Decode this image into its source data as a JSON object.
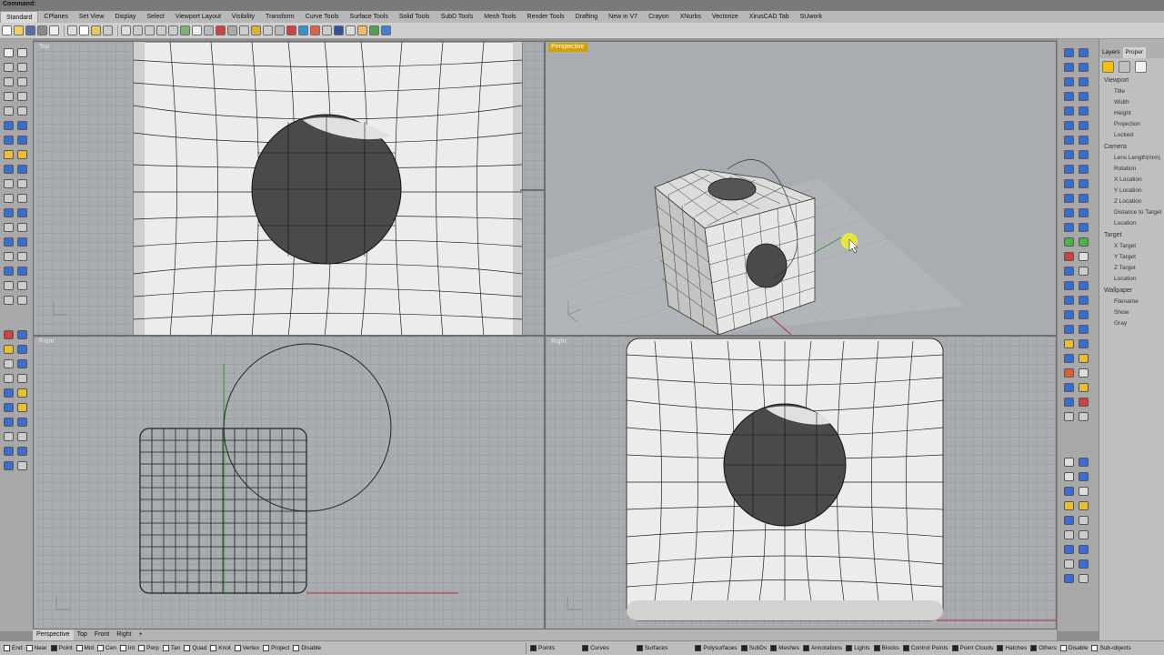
{
  "command": {
    "label": "Command:"
  },
  "tabs": [
    {
      "label": "Standard",
      "active": true
    },
    {
      "label": "CPlanes"
    },
    {
      "label": "Set View"
    },
    {
      "label": "Display"
    },
    {
      "label": "Select"
    },
    {
      "label": "Viewport Layout"
    },
    {
      "label": "Visibility"
    },
    {
      "label": "Transform"
    },
    {
      "label": "Curve Tools"
    },
    {
      "label": "Surface Tools"
    },
    {
      "label": "Solid Tools"
    },
    {
      "label": "SubD Tools"
    },
    {
      "label": "Mesh Tools"
    },
    {
      "label": "Render Tools"
    },
    {
      "label": "Drafting"
    },
    {
      "label": "New in V7"
    },
    {
      "label": "Crayon"
    },
    {
      "label": "XNurbs"
    },
    {
      "label": "Vectorize"
    },
    {
      "label": "XirusCAD Tab"
    },
    {
      "label": "SUwork"
    }
  ],
  "viewports": {
    "top": {
      "title": "Top"
    },
    "perspective": {
      "title": "Perspective"
    },
    "front": {
      "title": "Front"
    },
    "right": {
      "title": "Right"
    }
  },
  "viewport_tabs": [
    {
      "label": "Perspective",
      "active": true
    },
    {
      "label": "Top"
    },
    {
      "label": "Front"
    },
    {
      "label": "Right"
    },
    {
      "label": "+"
    }
  ],
  "osnaps": [
    {
      "label": "End",
      "checked": false
    },
    {
      "label": "Near",
      "checked": false
    },
    {
      "label": "Point",
      "checked": true
    },
    {
      "label": "Mid",
      "checked": false
    },
    {
      "label": "Cen",
      "checked": false
    },
    {
      "label": "Int",
      "checked": false
    },
    {
      "label": "Perp",
      "checked": false
    },
    {
      "label": "Tan",
      "checked": false
    },
    {
      "label": "Quad",
      "checked": false
    },
    {
      "label": "Knot",
      "checked": false
    },
    {
      "label": "Vertex",
      "checked": false
    },
    {
      "label": "Project",
      "checked": false
    },
    {
      "label": "Disable",
      "checked": false
    }
  ],
  "filters": [
    {
      "label": "Points"
    },
    {
      "label": "Curves"
    },
    {
      "label": "Surfaces"
    },
    {
      "label": "Polysurfaces"
    },
    {
      "label": "SubDs"
    },
    {
      "label": "Meshes"
    },
    {
      "label": "Annotations"
    },
    {
      "label": "Lights"
    },
    {
      "label": "Blocks"
    },
    {
      "label": "Control Points"
    },
    {
      "label": "Point Clouds"
    },
    {
      "label": "Hatches"
    },
    {
      "label": "Others"
    },
    {
      "label": "Disable"
    },
    {
      "label": "Sub-objects"
    }
  ],
  "panel": {
    "tabs": [
      {
        "label": "Layers"
      },
      {
        "label": "Proper",
        "active": true
      }
    ],
    "viewport_header": "Viewport",
    "viewport_props": [
      "Title",
      "Width",
      "Height",
      "Projection",
      "Locked"
    ],
    "camera_header": "Camera",
    "camera_props": [
      "Lens Length(mm)",
      "Rotation",
      "X Location",
      "Y Location",
      "Z Location",
      "Distance to Target",
      "Location"
    ],
    "target_header": "Target",
    "target_props": [
      "X Target",
      "Y Target",
      "Z Target",
      "Location"
    ],
    "wallpaper_header": "Wallpaper",
    "wallpaper_props": [
      "Filename",
      "Show",
      "Gray"
    ]
  },
  "colors": {
    "active_viewport": "#d4a100",
    "selection": "#f3c000",
    "x_axis": "#b03030",
    "y_axis": "#2f9a2f"
  }
}
